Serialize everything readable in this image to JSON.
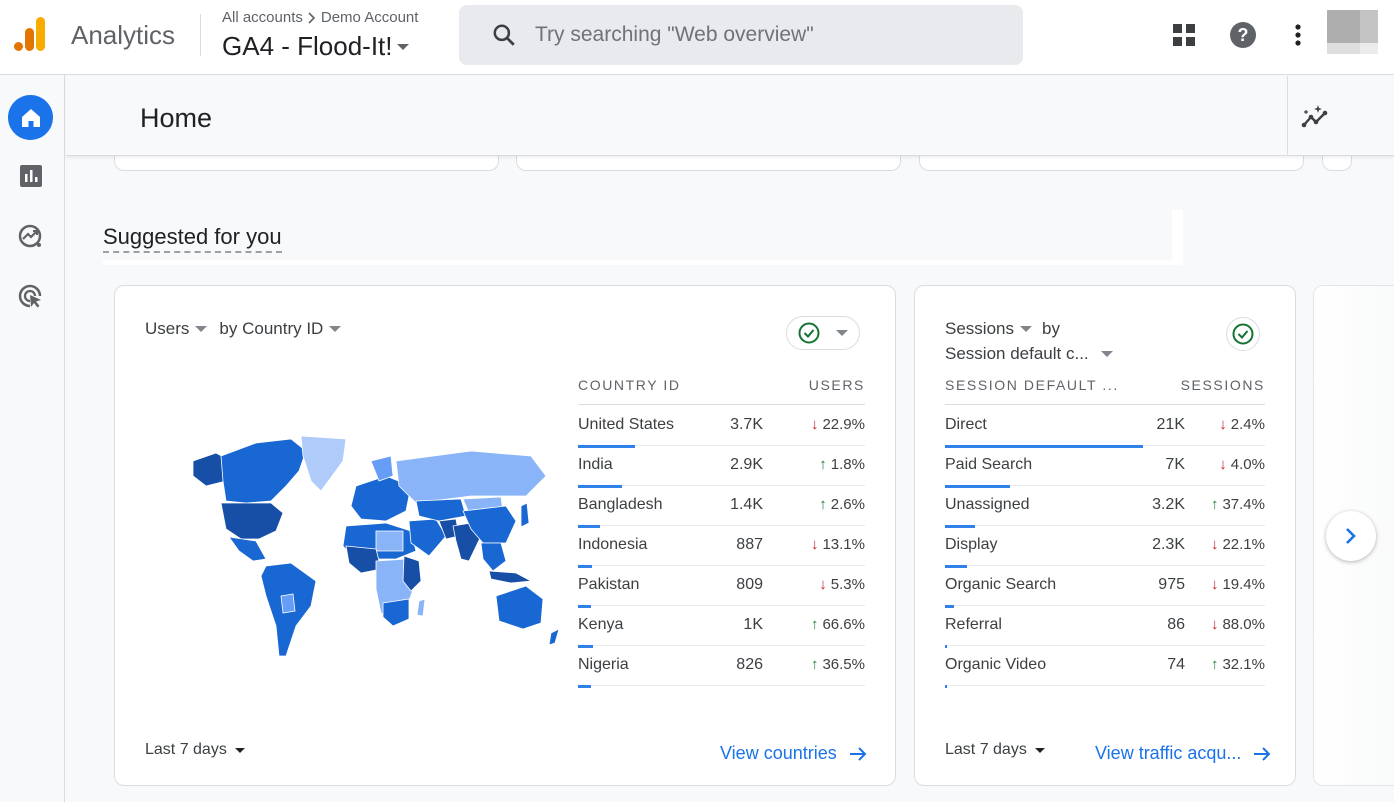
{
  "app": {
    "product_name": "Analytics",
    "breadcrumb": {
      "parent": "All accounts",
      "account": "Demo Account"
    },
    "property": "GA4 - Flood-It!",
    "search": {
      "placeholder": "Try searching \"Web overview\"",
      "value": ""
    },
    "icons": {
      "apps": "apps-grid-icon",
      "help": "help-icon",
      "more": "more-vert-icon"
    }
  },
  "nav": {
    "items": [
      {
        "name": "home",
        "icon": "home-icon",
        "active": true
      },
      {
        "name": "reports",
        "icon": "bar-chart-icon",
        "active": false
      },
      {
        "name": "explore",
        "icon": "explore-icon",
        "active": false
      },
      {
        "name": "advertising",
        "icon": "advertising-icon",
        "active": false
      }
    ]
  },
  "header": {
    "title": "Home",
    "insights_icon": "insights-icon"
  },
  "section": {
    "title": "Suggested for you"
  },
  "colors": {
    "accent": "#1a73e8",
    "down": "#c5221f",
    "up": "#188038",
    "check": "#137333"
  },
  "cards": [
    {
      "metric": "Users",
      "by": "by Country ID",
      "col_dimension": "COUNTRY ID",
      "col_metric": "USERS",
      "rows": [
        {
          "label": "United States",
          "value": "3.7K",
          "direction": "down",
          "change": "22.9%",
          "share": 1.0
        },
        {
          "label": "India",
          "value": "2.9K",
          "direction": "up",
          "change": "1.8%",
          "share": 0.78
        },
        {
          "label": "Bangladesh",
          "value": "1.4K",
          "direction": "up",
          "change": "2.6%",
          "share": 0.38
        },
        {
          "label": "Indonesia",
          "value": "887",
          "direction": "down",
          "change": "13.1%",
          "share": 0.24
        },
        {
          "label": "Pakistan",
          "value": "809",
          "direction": "down",
          "change": "5.3%",
          "share": 0.22
        },
        {
          "label": "Kenya",
          "value": "1K",
          "direction": "up",
          "change": "66.6%",
          "share": 0.27
        },
        {
          "label": "Nigeria",
          "value": "826",
          "direction": "up",
          "change": "36.5%",
          "share": 0.22
        }
      ],
      "date_range": "Last 7 days",
      "link": "View countries"
    },
    {
      "metric": "Sessions",
      "by": "by",
      "dimension": "Session default c...",
      "col_dimension": "SESSION DEFAULT ...",
      "col_metric": "SESSIONS",
      "rows": [
        {
          "label": "Direct",
          "value": "21K",
          "direction": "down",
          "change": "2.4%",
          "share": 1.0
        },
        {
          "label": "Paid Search",
          "value": "7K",
          "direction": "down",
          "change": "4.0%",
          "share": 0.33
        },
        {
          "label": "Unassigned",
          "value": "3.2K",
          "direction": "up",
          "change": "37.4%",
          "share": 0.15
        },
        {
          "label": "Display",
          "value": "2.3K",
          "direction": "down",
          "change": "22.1%",
          "share": 0.11
        },
        {
          "label": "Organic Search",
          "value": "975",
          "direction": "down",
          "change": "19.4%",
          "share": 0.046
        },
        {
          "label": "Referral",
          "value": "86",
          "direction": "down",
          "change": "88.0%",
          "share": 0.004
        },
        {
          "label": "Organic Video",
          "value": "74",
          "direction": "up",
          "change": "32.1%",
          "share": 0.0035
        }
      ],
      "date_range": "Last 7 days",
      "link": "View traffic acqu..."
    }
  ]
}
